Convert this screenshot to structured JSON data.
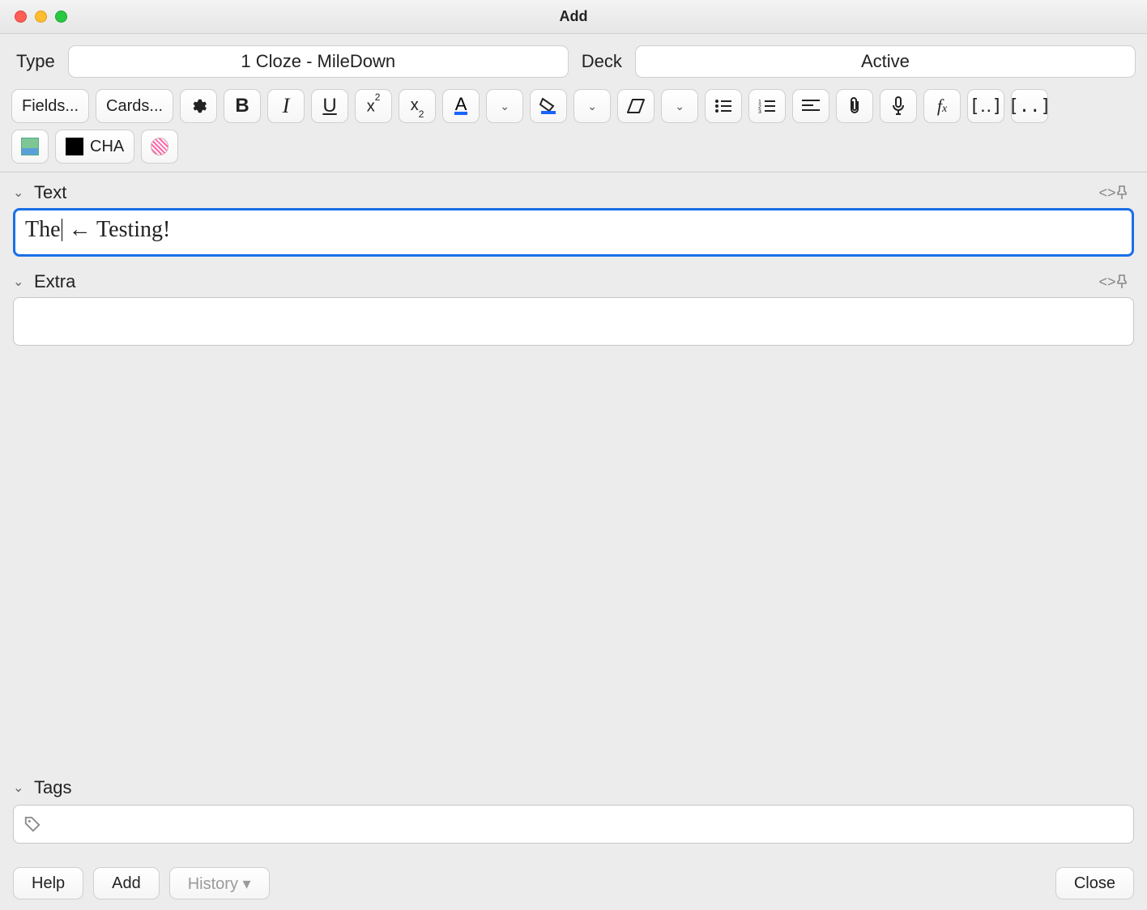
{
  "window": {
    "title": "Add"
  },
  "selectors": {
    "type_label": "Type",
    "type_value": "1 Cloze - MileDown",
    "deck_label": "Deck",
    "deck_value": "Active"
  },
  "toolbar": {
    "fields_btn": "Fields...",
    "cards_btn": "Cards...",
    "cha_label": "CHA"
  },
  "fields": {
    "text": {
      "label": "Text",
      "value_before_cursor": "The",
      "value_after_cursor": " ← Testing!"
    },
    "extra": {
      "label": "Extra",
      "value": ""
    }
  },
  "tags": {
    "label": "Tags"
  },
  "bottom": {
    "help": "Help",
    "add": "Add",
    "history": "History ▾",
    "close": "Close"
  }
}
